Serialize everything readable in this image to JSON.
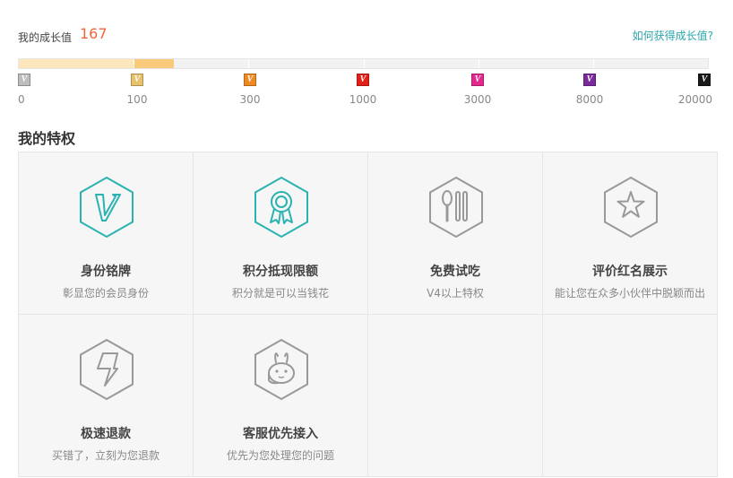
{
  "growth": {
    "label": "我的成长值",
    "value": "167",
    "how_link": "如何获得成长值?",
    "progress_fraction": 0.225
  },
  "levels": [
    {
      "value": "0",
      "badge": "V0",
      "color": "#bdbdbd"
    },
    {
      "value": "100",
      "badge": "V1",
      "color": "#e8c26a"
    },
    {
      "value": "300",
      "badge": "V2",
      "color": "#ef8a22"
    },
    {
      "value": "1000",
      "badge": "V3",
      "color": "#e22018"
    },
    {
      "value": "3000",
      "badge": "V4",
      "color": "#e4288c"
    },
    {
      "value": "8000",
      "badge": "V5",
      "color": "#7a2a9a"
    },
    {
      "value": "20000",
      "badge": "V6",
      "color": "#1a1a1a"
    }
  ],
  "privileges_title": "我的特权",
  "privileges": [
    {
      "title": "身份铭牌",
      "desc": "彰显您的会员身份",
      "icon": "v-badge-icon",
      "active": true
    },
    {
      "title": "积分抵现限额",
      "desc": "积分就是可以当钱花",
      "icon": "award-ribbon-icon",
      "active": true
    },
    {
      "title": "免费试吃",
      "desc": "V4以上特权",
      "icon": "spoon-fork-icon",
      "active": false
    },
    {
      "title": "评价红名展示",
      "desc": "能让您在众多小伙伴中脱颖而出",
      "icon": "star-icon",
      "active": false
    },
    {
      "title": "极速退款",
      "desc": "买错了，立刻为您退款",
      "icon": "lightning-icon",
      "active": false
    },
    {
      "title": "客服优先接入",
      "desc": "优先为您处理您的问题",
      "icon": "customer-service-icon",
      "active": false
    }
  ],
  "colors": {
    "accent": "#f0643c",
    "link": "#2aa6ad",
    "active_icon": "#2ab3b0",
    "inactive_icon": "#999999"
  }
}
